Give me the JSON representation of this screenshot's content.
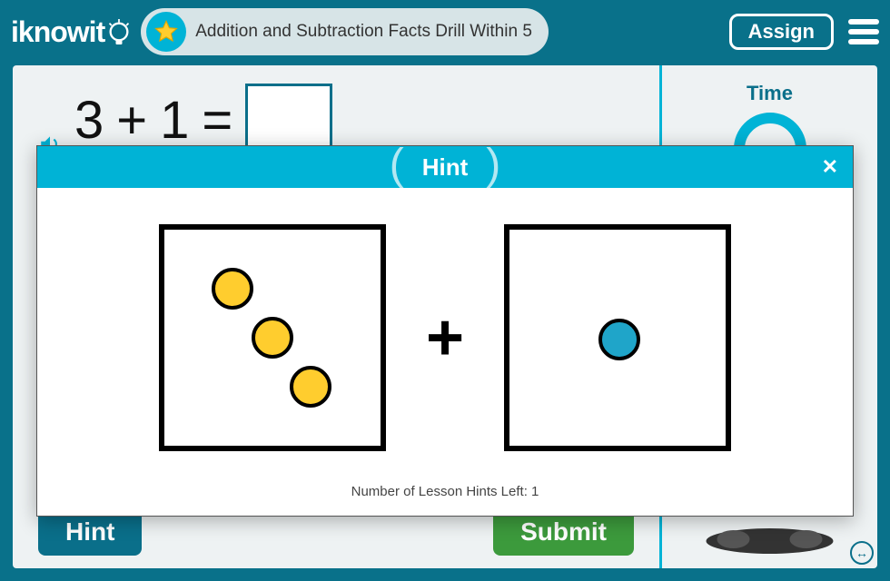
{
  "header": {
    "logo_text": "iknowit",
    "lesson_title": "Addition and Subtraction Facts Drill Within 5",
    "assign_label": "Assign"
  },
  "question": {
    "operand1": "3",
    "operator": "+",
    "operand2": "1",
    "equals": "="
  },
  "buttons": {
    "hint": "Hint",
    "submit": "Submit"
  },
  "sidebar": {
    "time_label": "Time"
  },
  "modal": {
    "title": "Hint",
    "hints_left_text": "Number of Lesson Hints Left: 1",
    "plus_symbol": "+",
    "left_dots": 3,
    "right_dots": 1
  }
}
